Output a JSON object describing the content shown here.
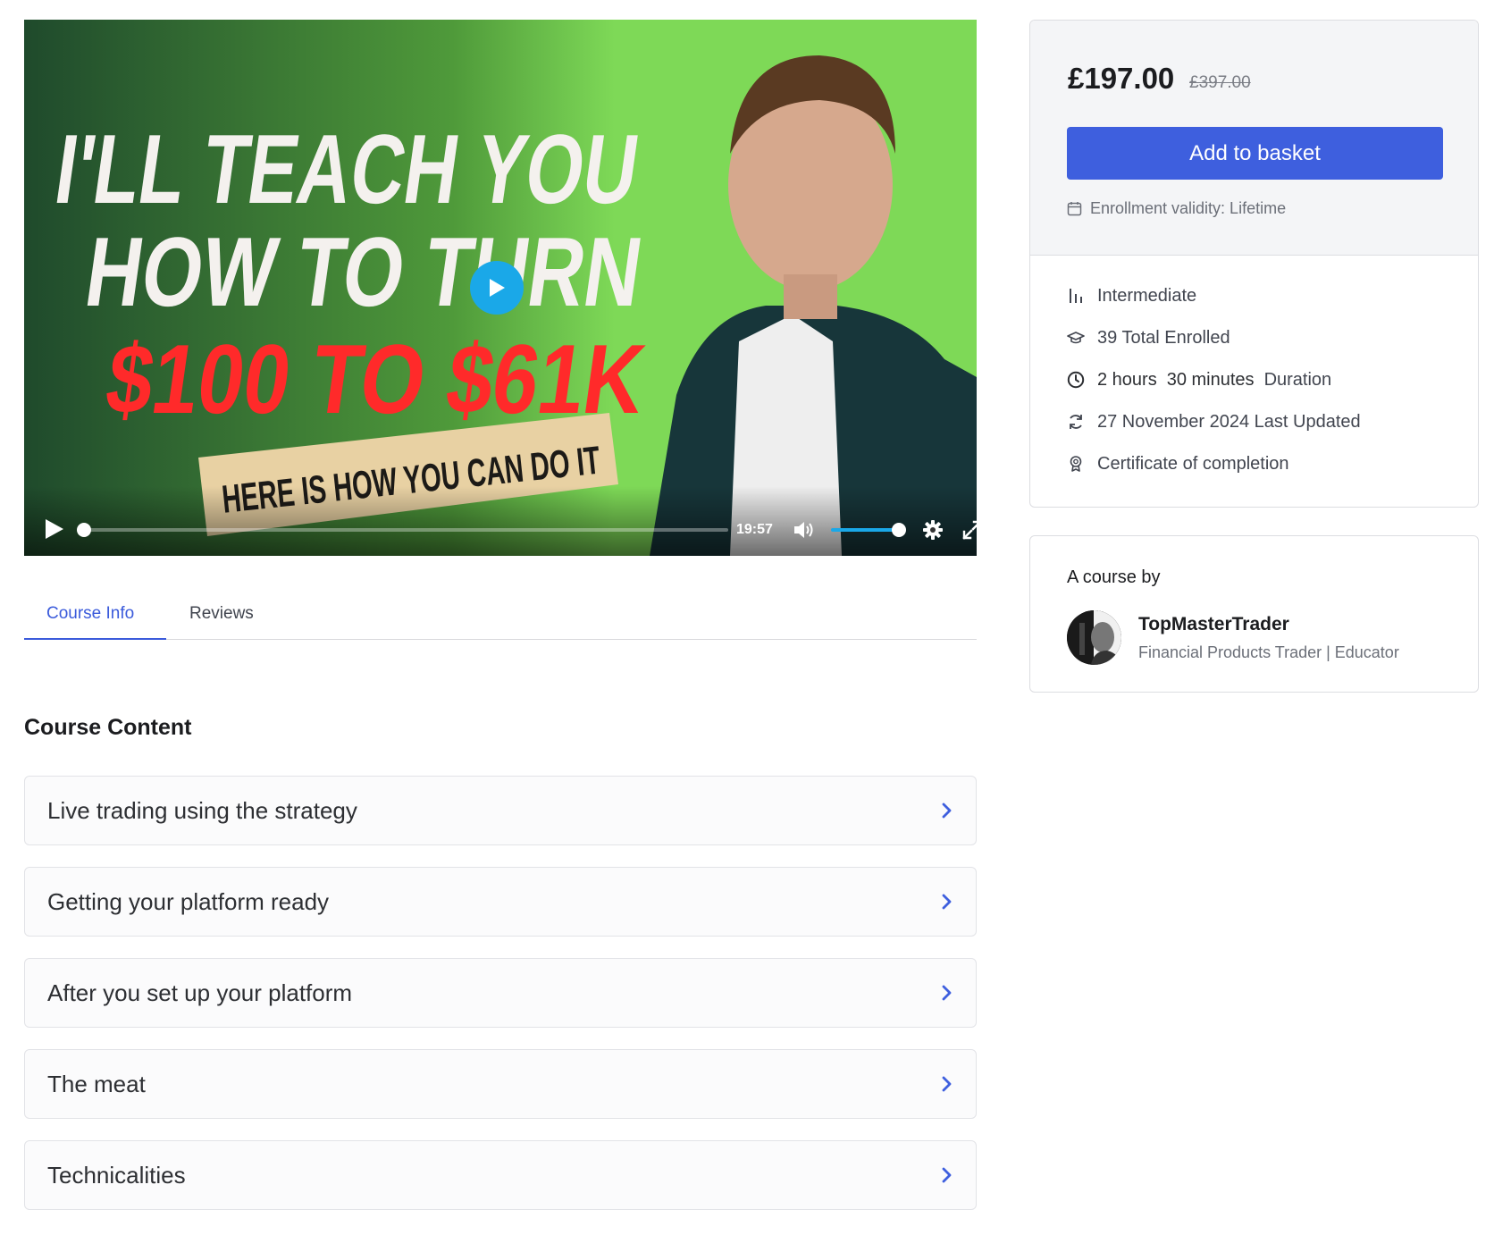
{
  "video": {
    "thumbnail_lines": [
      "I'LL TEACH YOU",
      "HOW TO TURN",
      "$100 TO $61K",
      "HERE IS HOW YOU CAN DO IT"
    ],
    "time": "19:57",
    "progress": 0.0,
    "volume": 1.0
  },
  "tabs": [
    {
      "label": "Course Info",
      "active": true
    },
    {
      "label": "Reviews",
      "active": false
    }
  ],
  "course_content": {
    "title": "Course Content",
    "topics": [
      {
        "label": "Live trading using the strategy"
      },
      {
        "label": "Getting your platform ready"
      },
      {
        "label": "After you set up your platform"
      },
      {
        "label": "The meat"
      },
      {
        "label": "Technicalities"
      }
    ]
  },
  "pricing": {
    "price": "£197.00",
    "old_price": "£397.00",
    "add_button": "Add to basket",
    "validity": "Enrollment validity: Lifetime"
  },
  "meta": {
    "level": "Intermediate",
    "enrolled": "39 Total Enrolled",
    "duration_hours": "2 hours",
    "duration_minutes": "30 minutes",
    "duration_label": "Duration",
    "updated": "27 November 2024 Last Updated",
    "certificate": "Certificate of completion"
  },
  "author": {
    "by_label": "A course by",
    "name": "TopMasterTrader",
    "role": "Financial Products Trader | Educator"
  },
  "colors": {
    "accent": "#3e5fde",
    "tab_active": "#3b5bdb",
    "video_green": "#7ed957",
    "play_blue": "#1aa8e8"
  }
}
